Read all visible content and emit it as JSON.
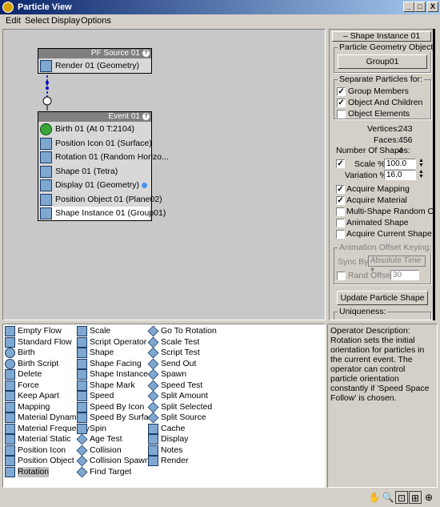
{
  "window": {
    "title": "Particle View",
    "minimize": "_",
    "maximize": "□",
    "close": "X"
  },
  "menu": [
    "Edit",
    "Select",
    "Display",
    "Options"
  ],
  "nodes": {
    "source": {
      "title": "PF Source 01",
      "ops": [
        "Render 01 (Geometry)"
      ]
    },
    "event": {
      "title": "Event 01",
      "ops": [
        "Birth 01 (At 0 T:2104)",
        "Position Icon 01 (Surface)",
        "Rotation 01 (Random Horizo...",
        "Shape 01 (Tetra)",
        "Display 01 (Geometry)",
        "Position Object 01 (Plane02)",
        "Shape Instance 01 (Group01)"
      ]
    }
  },
  "panel": {
    "rollout_title": "Shape Instance 01",
    "geometry_object_label": "Particle Geometry Object:",
    "geometry_object_button": "Group01",
    "separate_label": "Separate Particles for:",
    "group_members": "Group Members",
    "object_and_children": "Object And Children",
    "object_elements": "Object Elements",
    "vertices_label": "Vertices:",
    "vertices": "243",
    "faces_label": "Faces:",
    "faces": "456",
    "shapes_label": "Number Of Shapes:",
    "shapes": "4",
    "scale_label": "Scale %",
    "scale": "100.0",
    "variation_label": "Variation %",
    "variation": "16.0",
    "acquire_mapping": "Acquire Mapping",
    "acquire_material": "Acquire Material",
    "multi_shape": "Multi-Shape Random Order",
    "animated_shape": "Animated Shape",
    "acquire_current_shape": "Acquire Current Shape",
    "anim_offset_label": "Animation Offset Keying:",
    "sync_by_label": "Sync By:",
    "sync_by_value": "Absolute Time",
    "rand_offset_label": "Rand Offset:",
    "rand_offset_value": "30",
    "update_button": "Update Particle Shape",
    "uniqueness_label": "Uniqueness:"
  },
  "depot": {
    "col1": [
      "Empty Flow",
      "Standard Flow",
      "Birth",
      "Birth Script",
      "Delete",
      "Force",
      "Keep Apart",
      "Mapping",
      "Material Dynamic",
      "Material Frequency",
      "Material Static",
      "Position Icon",
      "Position Object",
      "Rotation"
    ],
    "col2": [
      "Scale",
      "Script Operator",
      "Shape",
      "Shape Facing",
      "Shape Instance",
      "Shape Mark",
      "Speed",
      "Speed By Icon",
      "Speed By Surface",
      "Spin",
      "Age Test",
      "Collision",
      "Collision Spawn",
      "Find Target"
    ],
    "col3": [
      "Go To Rotation",
      "Scale Test",
      "Script Test",
      "Send Out",
      "Spawn",
      "Speed Test",
      "Split Amount",
      "Split Selected",
      "Split Source",
      "Cache",
      "Display",
      "Notes",
      "Render"
    ],
    "selected": "Rotation"
  },
  "description": {
    "title": "Operator Description:",
    "text": "Rotation sets the initial orientation for particles in the current event. The operator can control particle orientation constantly if 'Speed Space Follow' is chosen."
  },
  "status_icons": [
    "pan-icon",
    "zoom-icon",
    "zoom-region-icon",
    "zoom-extents-icon",
    "zoom-all-icon"
  ],
  "colors": {
    "title_start": "#0a246a",
    "title_end": "#a6caf0",
    "viewport": "#c8c8c8",
    "node_header": "#808080"
  }
}
